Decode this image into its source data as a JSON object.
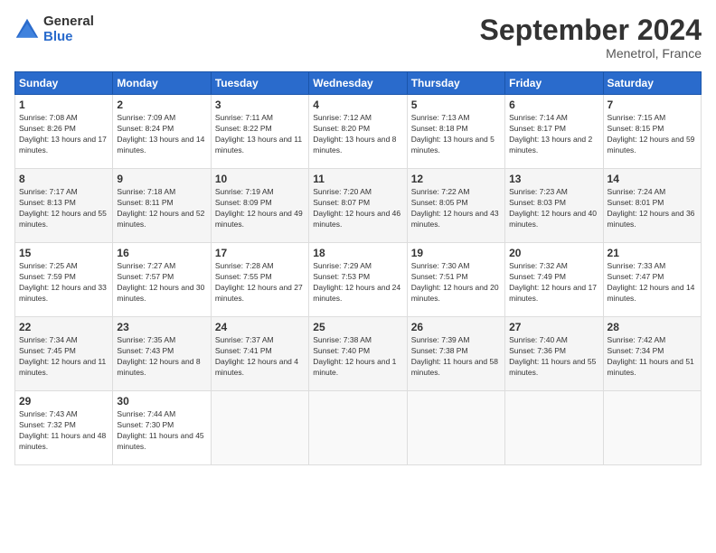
{
  "logo": {
    "general": "General",
    "blue": "Blue"
  },
  "title": "September 2024",
  "location": "Menetrol, France",
  "days_header": [
    "Sunday",
    "Monday",
    "Tuesday",
    "Wednesday",
    "Thursday",
    "Friday",
    "Saturday"
  ],
  "weeks": [
    [
      {
        "day": "1",
        "sunrise": "Sunrise: 7:08 AM",
        "sunset": "Sunset: 8:26 PM",
        "daylight": "Daylight: 13 hours and 17 minutes."
      },
      {
        "day": "2",
        "sunrise": "Sunrise: 7:09 AM",
        "sunset": "Sunset: 8:24 PM",
        "daylight": "Daylight: 13 hours and 14 minutes."
      },
      {
        "day": "3",
        "sunrise": "Sunrise: 7:11 AM",
        "sunset": "Sunset: 8:22 PM",
        "daylight": "Daylight: 13 hours and 11 minutes."
      },
      {
        "day": "4",
        "sunrise": "Sunrise: 7:12 AM",
        "sunset": "Sunset: 8:20 PM",
        "daylight": "Daylight: 13 hours and 8 minutes."
      },
      {
        "day": "5",
        "sunrise": "Sunrise: 7:13 AM",
        "sunset": "Sunset: 8:18 PM",
        "daylight": "Daylight: 13 hours and 5 minutes."
      },
      {
        "day": "6",
        "sunrise": "Sunrise: 7:14 AM",
        "sunset": "Sunset: 8:17 PM",
        "daylight": "Daylight: 13 hours and 2 minutes."
      },
      {
        "day": "7",
        "sunrise": "Sunrise: 7:15 AM",
        "sunset": "Sunset: 8:15 PM",
        "daylight": "Daylight: 12 hours and 59 minutes."
      }
    ],
    [
      {
        "day": "8",
        "sunrise": "Sunrise: 7:17 AM",
        "sunset": "Sunset: 8:13 PM",
        "daylight": "Daylight: 12 hours and 55 minutes."
      },
      {
        "day": "9",
        "sunrise": "Sunrise: 7:18 AM",
        "sunset": "Sunset: 8:11 PM",
        "daylight": "Daylight: 12 hours and 52 minutes."
      },
      {
        "day": "10",
        "sunrise": "Sunrise: 7:19 AM",
        "sunset": "Sunset: 8:09 PM",
        "daylight": "Daylight: 12 hours and 49 minutes."
      },
      {
        "day": "11",
        "sunrise": "Sunrise: 7:20 AM",
        "sunset": "Sunset: 8:07 PM",
        "daylight": "Daylight: 12 hours and 46 minutes."
      },
      {
        "day": "12",
        "sunrise": "Sunrise: 7:22 AM",
        "sunset": "Sunset: 8:05 PM",
        "daylight": "Daylight: 12 hours and 43 minutes."
      },
      {
        "day": "13",
        "sunrise": "Sunrise: 7:23 AM",
        "sunset": "Sunset: 8:03 PM",
        "daylight": "Daylight: 12 hours and 40 minutes."
      },
      {
        "day": "14",
        "sunrise": "Sunrise: 7:24 AM",
        "sunset": "Sunset: 8:01 PM",
        "daylight": "Daylight: 12 hours and 36 minutes."
      }
    ],
    [
      {
        "day": "15",
        "sunrise": "Sunrise: 7:25 AM",
        "sunset": "Sunset: 7:59 PM",
        "daylight": "Daylight: 12 hours and 33 minutes."
      },
      {
        "day": "16",
        "sunrise": "Sunrise: 7:27 AM",
        "sunset": "Sunset: 7:57 PM",
        "daylight": "Daylight: 12 hours and 30 minutes."
      },
      {
        "day": "17",
        "sunrise": "Sunrise: 7:28 AM",
        "sunset": "Sunset: 7:55 PM",
        "daylight": "Daylight: 12 hours and 27 minutes."
      },
      {
        "day": "18",
        "sunrise": "Sunrise: 7:29 AM",
        "sunset": "Sunset: 7:53 PM",
        "daylight": "Daylight: 12 hours and 24 minutes."
      },
      {
        "day": "19",
        "sunrise": "Sunrise: 7:30 AM",
        "sunset": "Sunset: 7:51 PM",
        "daylight": "Daylight: 12 hours and 20 minutes."
      },
      {
        "day": "20",
        "sunrise": "Sunrise: 7:32 AM",
        "sunset": "Sunset: 7:49 PM",
        "daylight": "Daylight: 12 hours and 17 minutes."
      },
      {
        "day": "21",
        "sunrise": "Sunrise: 7:33 AM",
        "sunset": "Sunset: 7:47 PM",
        "daylight": "Daylight: 12 hours and 14 minutes."
      }
    ],
    [
      {
        "day": "22",
        "sunrise": "Sunrise: 7:34 AM",
        "sunset": "Sunset: 7:45 PM",
        "daylight": "Daylight: 12 hours and 11 minutes."
      },
      {
        "day": "23",
        "sunrise": "Sunrise: 7:35 AM",
        "sunset": "Sunset: 7:43 PM",
        "daylight": "Daylight: 12 hours and 8 minutes."
      },
      {
        "day": "24",
        "sunrise": "Sunrise: 7:37 AM",
        "sunset": "Sunset: 7:41 PM",
        "daylight": "Daylight: 12 hours and 4 minutes."
      },
      {
        "day": "25",
        "sunrise": "Sunrise: 7:38 AM",
        "sunset": "Sunset: 7:40 PM",
        "daylight": "Daylight: 12 hours and 1 minute."
      },
      {
        "day": "26",
        "sunrise": "Sunrise: 7:39 AM",
        "sunset": "Sunset: 7:38 PM",
        "daylight": "Daylight: 11 hours and 58 minutes."
      },
      {
        "day": "27",
        "sunrise": "Sunrise: 7:40 AM",
        "sunset": "Sunset: 7:36 PM",
        "daylight": "Daylight: 11 hours and 55 minutes."
      },
      {
        "day": "28",
        "sunrise": "Sunrise: 7:42 AM",
        "sunset": "Sunset: 7:34 PM",
        "daylight": "Daylight: 11 hours and 51 minutes."
      }
    ],
    [
      {
        "day": "29",
        "sunrise": "Sunrise: 7:43 AM",
        "sunset": "Sunset: 7:32 PM",
        "daylight": "Daylight: 11 hours and 48 minutes."
      },
      {
        "day": "30",
        "sunrise": "Sunrise: 7:44 AM",
        "sunset": "Sunset: 7:30 PM",
        "daylight": "Daylight: 11 hours and 45 minutes."
      },
      null,
      null,
      null,
      null,
      null
    ]
  ]
}
